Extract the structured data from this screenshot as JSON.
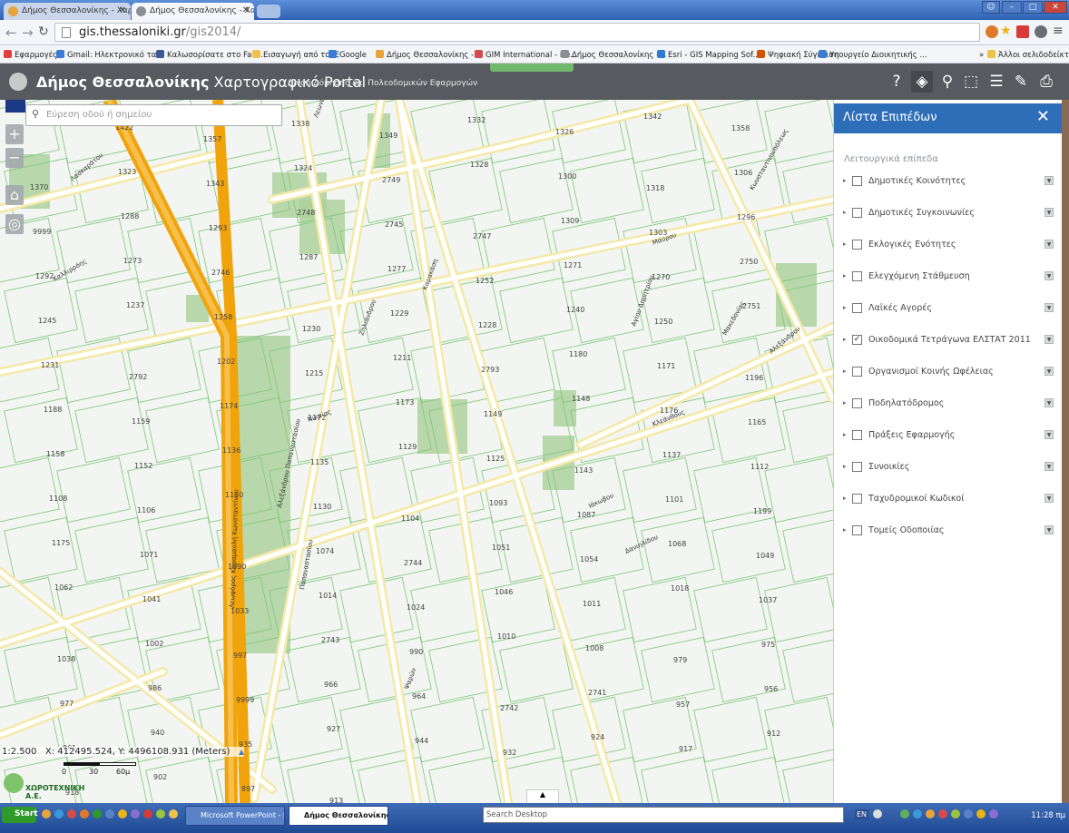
{
  "browser": {
    "tabs": [
      {
        "title": "Δήμος Θεσσαλονίκης - Χαρτο",
        "favicon_color": "#e8a43a"
      },
      {
        "title": "Δήμος Θεσσαλονίκης - Χαρτο",
        "favicon_color": "#8a8f97"
      }
    ],
    "tab_close": "✕",
    "window_controls": [
      "☺",
      "–",
      "□",
      "✕"
    ],
    "url_host": "gis.thessaloniki.gr",
    "url_path": "/gis2014/",
    "bookmarks": [
      {
        "label": "Εφαρμογές",
        "color": "#e43d3d"
      },
      {
        "label": "Gmail: Ηλεκτρονικό τα...",
        "color": "#3a7bd5"
      },
      {
        "label": "Καλωσορίσατε στο Fac...",
        "color": "#3b5998"
      },
      {
        "label": "Εισαγωγή από το IE",
        "color": "#f0c24b"
      },
      {
        "label": "Google",
        "color": "#3a7bd5"
      },
      {
        "label": "Δήμος Θεσσαλονίκης -...",
        "color": "#e8a43a"
      },
      {
        "label": "GIM International - Ne...",
        "color": "#d84a4a"
      },
      {
        "label": "Δήμος Θεσσαλονίκης -...",
        "color": "#8a8f97"
      },
      {
        "label": "Esri - GIS Mapping Sof...",
        "color": "#2d7dd2"
      },
      {
        "label": "Ψηφιακή Σύγκλιση",
        "color": "#d35400"
      },
      {
        "label": "Υπουργείο Διοικητικής ...",
        "color": "#3a7bd5"
      },
      {
        "label": "»",
        "color": "#f3f5f8"
      },
      {
        "label": "Άλλοι σελιδοδείκτες",
        "color": "#f0c24b"
      }
    ]
  },
  "app": {
    "title_bold": "Δήμος Θεσσαλονίκης",
    "title_rest": "Χαρτογραφικό Portal",
    "subtitle": "Δ/νση Δόμησης και Πολεοδομικών Εφαρμογών",
    "tools": [
      {
        "name": "help-icon",
        "glyph": "?"
      },
      {
        "name": "layers-icon",
        "glyph": "◈"
      },
      {
        "name": "location-pin-icon",
        "glyph": "⚲"
      },
      {
        "name": "select-icon",
        "glyph": "⬚"
      },
      {
        "name": "legend-list-icon",
        "glyph": "☰"
      },
      {
        "name": "measure-icon",
        "glyph": "✎"
      },
      {
        "name": "print-icon",
        "glyph": "⎙"
      }
    ]
  },
  "map": {
    "search_placeholder": "Εύρεση οδού ή σημείου",
    "zoom_in": "+",
    "zoom_out": "−",
    "home": "⌂",
    "locate": "◎",
    "scale": "1:2.500",
    "coords": "X: 412495.524, Y: 4496108.931 (Meters)",
    "scale_ticks": [
      "0",
      "30",
      "60μ"
    ],
    "logo_text": "ΧΩΡΟΤΕΧΝΙΚΗ Α.Ε.",
    "collapse": "▲",
    "block_labels": [
      "1345",
      "1422",
      "1357",
      "1338",
      "1349",
      "1332",
      "1326",
      "1342",
      "1358",
      "1370",
      "1323",
      "1343",
      "1324",
      "2749",
      "1328",
      "1300",
      "1318",
      "1306",
      "9999",
      "1288",
      "1293",
      "2748",
      "2745",
      "2747",
      "1309",
      "1303",
      "1296",
      "1292",
      "1273",
      "2746",
      "1287",
      "1277",
      "1252",
      "1271",
      "1270",
      "2750",
      "1245",
      "1237",
      "1258",
      "1230",
      "1229",
      "1228",
      "1240",
      "1250",
      "2751",
      "1231",
      "2792",
      "1202",
      "1215",
      "1211",
      "2793",
      "1180",
      "1171",
      "1196",
      "1188",
      "1159",
      "1174",
      "1172",
      "1173",
      "1149",
      "1148",
      "1176",
      "1165",
      "1158",
      "1152",
      "1136",
      "1135",
      "1129",
      "1125",
      "1143",
      "1137",
      "1112",
      "1108",
      "1106",
      "1150",
      "1130",
      "1104",
      "1093",
      "1087",
      "1101",
      "1199",
      "1175",
      "1071",
      "1090",
      "1074",
      "2744",
      "1051",
      "1054",
      "1068",
      "1049",
      "1062",
      "1041",
      "1033",
      "1014",
      "1024",
      "1046",
      "1011",
      "1018",
      "1037",
      "1038",
      "1002",
      "997",
      "2743",
      "990",
      "1010",
      "1008",
      "979",
      "975",
      "977",
      "986",
      "9999",
      "966",
      "964",
      "2742",
      "2741",
      "957",
      "956",
      "961",
      "940",
      "935",
      "927",
      "944",
      "932",
      "924",
      "917",
      "912",
      "918",
      "902",
      "897",
      "913"
    ],
    "street_labels": [
      "Λεωφόρος Καραμανλή Κωνσταντίνου",
      "Παπαναστασίου",
      "Αλεξάνδρου Παπαναστασίου",
      "Κλεάνθους",
      "Νικαίας",
      "Κωνσταντινουπόλεως",
      "Καλλιρρόης",
      "Μαύρου",
      "Ψαρών",
      "Αγίου Δημητρίου",
      "Μακεδονίας",
      "Αλεξάνδρου",
      "Λασκαράτου",
      "Καρακάση",
      "Ιάκωβου",
      "Δανιηλίδου",
      "Λεωνίδου",
      "Ζηλιάνδρου"
    ]
  },
  "panel": {
    "title": "Λίστα Επιπέδων",
    "close": "✕",
    "section": "Λειτουργικά επίπεδα",
    "layers": [
      {
        "label": "Δημοτικές Κοινότητες",
        "checked": false
      },
      {
        "label": "Δημοτικές Συγκοινωνίες",
        "checked": false
      },
      {
        "label": "Εκλογικές Ενότητες",
        "checked": false
      },
      {
        "label": "Ελεγχόμενη Στάθμευση",
        "checked": false
      },
      {
        "label": "Λαϊκές Αγορές",
        "checked": false
      },
      {
        "label": "Οικοδομικά Τετράγωνα ΕΛΣΤΑΤ 2011",
        "checked": true
      },
      {
        "label": "Οργανισμοί Κοινής Ωφέλειας",
        "checked": false
      },
      {
        "label": "Ποδηλατόδρομος",
        "checked": false
      },
      {
        "label": "Πράξεις Εφαρμογής",
        "checked": false
      },
      {
        "label": "Συνοικίες",
        "checked": false
      },
      {
        "label": "Ταχυδρομικοί Κωδικοί",
        "checked": false
      },
      {
        "label": "Τομείς Οδοποιίας",
        "checked": false
      }
    ],
    "expand_glyph": "▸",
    "check_glyph": "✓",
    "dropdown_glyph": "▼"
  },
  "taskbar": {
    "start": "Start",
    "buttons": [
      {
        "label": "Microsoft PowerPoint - [...",
        "active": false
      },
      {
        "label": "Δήμος Θεσσαλονίκης ...",
        "active": true
      }
    ],
    "search_placeholder": "Search Desktop",
    "lang": "EN",
    "clock": "11:28 πμ"
  },
  "colors": {
    "header_bg": "#575a5e",
    "panel_header": "#2e6db8",
    "road_major": "#f0a30a",
    "road_secondary": "#f5e9a8",
    "park": "#a9cf9a",
    "block_outline": "#7ec87a"
  }
}
